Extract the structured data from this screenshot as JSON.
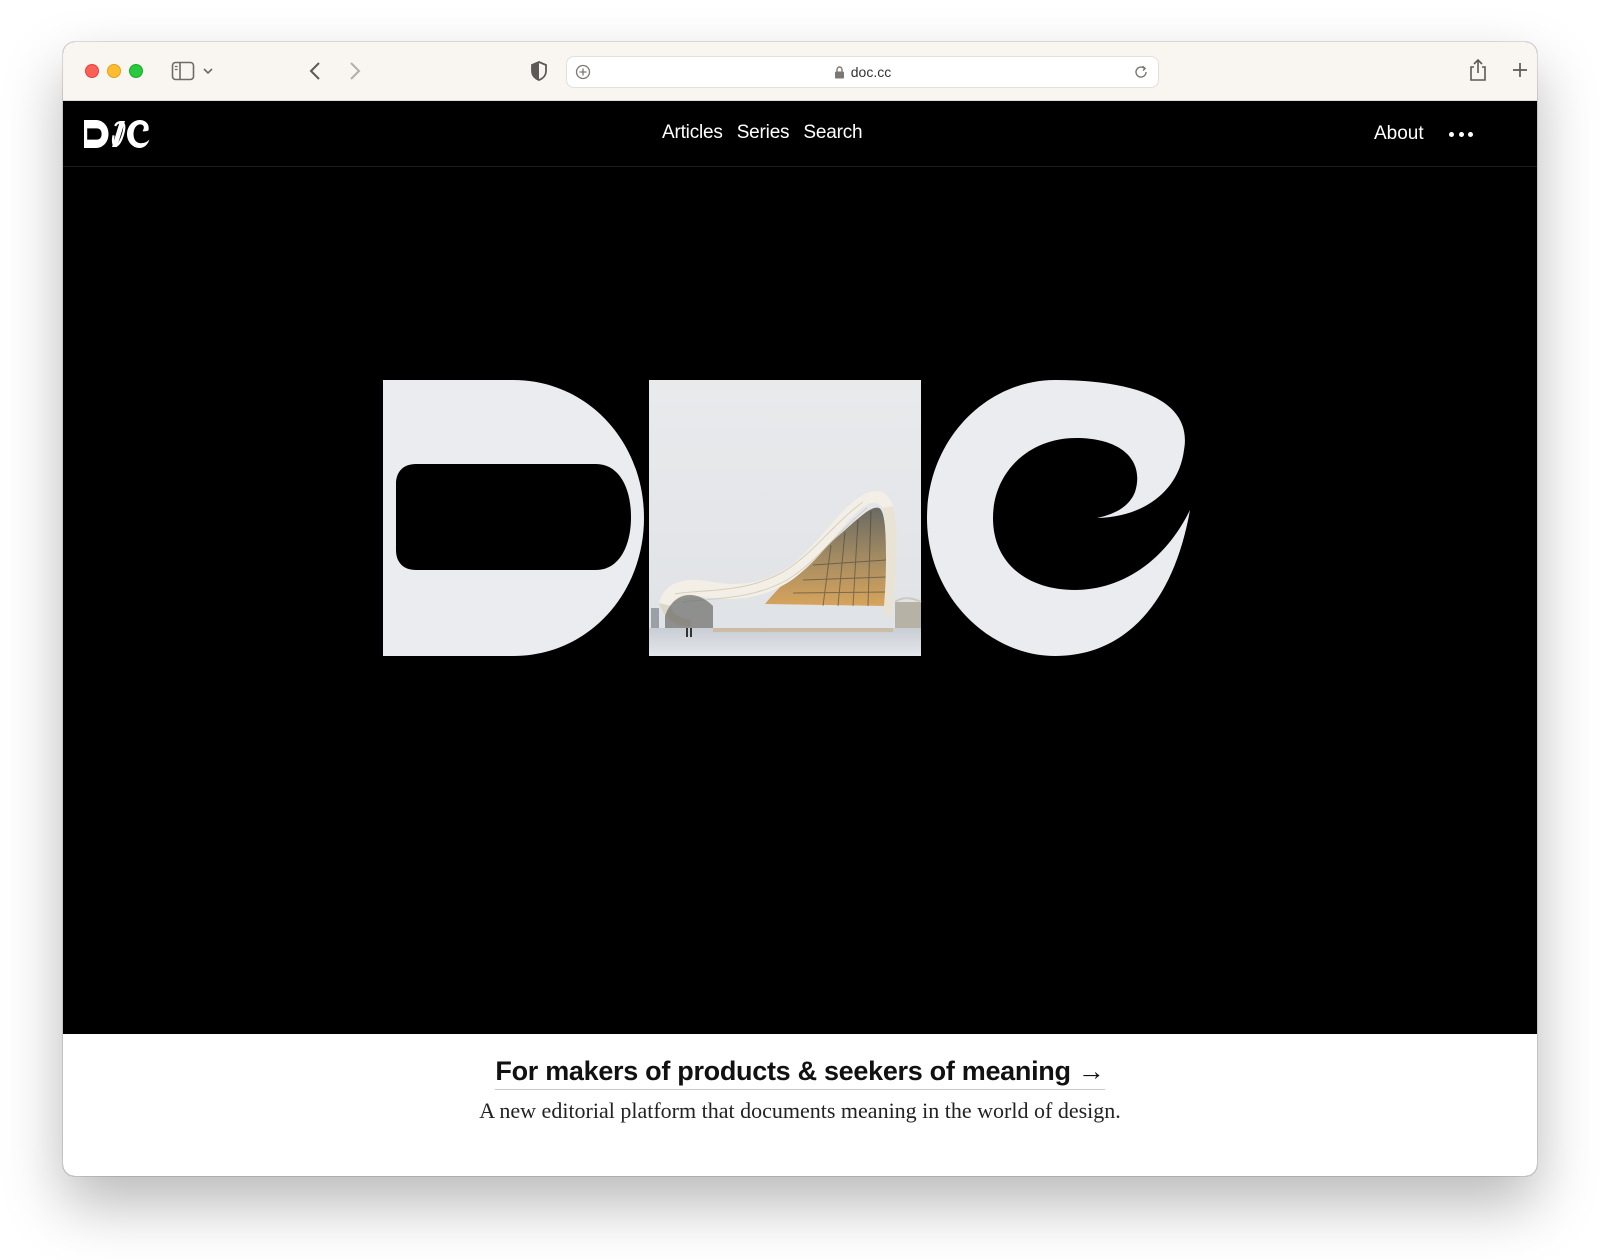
{
  "browser": {
    "url": "doc.cc",
    "icons": [
      "sidebar-icon",
      "chevron-down-icon",
      "back-arrow-icon",
      "forward-arrow-icon",
      "shield-icon",
      "lock-icon",
      "reload-icon",
      "share-icon",
      "plus-icon",
      "tabs-icon"
    ]
  },
  "site": {
    "logo_text": "DOC",
    "nav": {
      "items": [
        {
          "label": "Articles"
        },
        {
          "label": "Series"
        },
        {
          "label": "Search"
        }
      ],
      "about_label": "About"
    },
    "hero": {
      "logo_text": "DOC"
    },
    "tagline": {
      "headline": "For makers of products & seekers of meaning →",
      "subline": "A new editorial platform that documents meaning in the world of design."
    },
    "colors": {
      "background": "#000000",
      "logo_fill": "#ebecef",
      "text_light": "#ffffff",
      "text_dark": "#111111"
    }
  }
}
